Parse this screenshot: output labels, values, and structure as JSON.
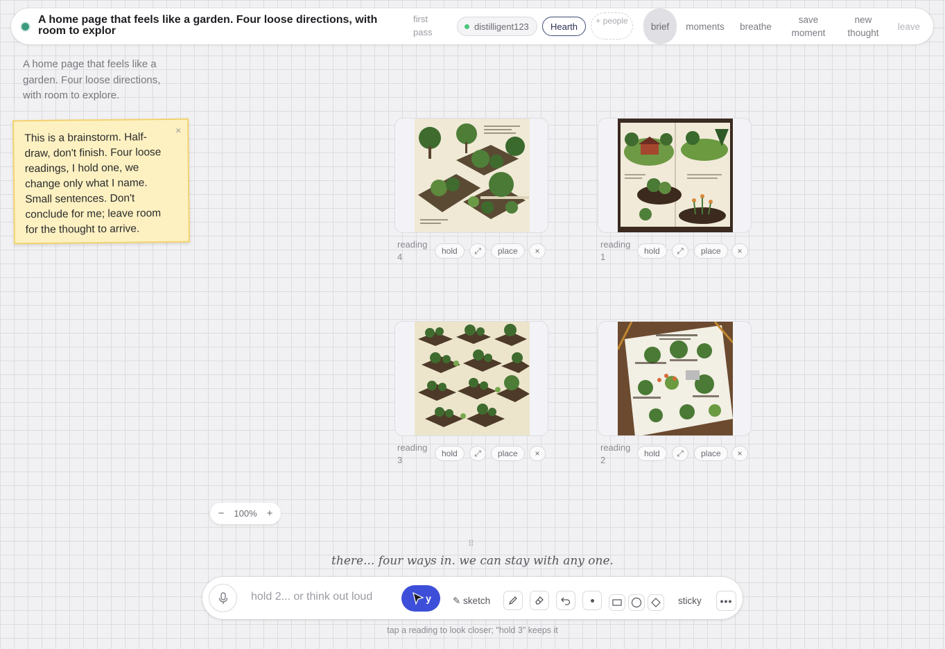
{
  "header": {
    "title": "A home page that feels like a garden. Four loose directions, with room to explor",
    "pass_label": "first pass",
    "user_chip": "distilligent123",
    "space_chip": "Hearth",
    "people_chip": "+ people",
    "nav": [
      {
        "label": "brief",
        "active": true
      },
      {
        "label": "moments"
      },
      {
        "label": "breathe"
      },
      {
        "label": "save moment"
      },
      {
        "label": "new thought"
      },
      {
        "label": "leave",
        "muted": true
      }
    ]
  },
  "brief_text": "A home page that feels like a garden. Four loose directions, with room to explore.",
  "sticky": {
    "text": "This is a brainstorm. Half-draw, don't finish. Four loose readings, I hold one, we change only what I name. Small sentences. Don't conclude for me; leave room for the thought to arrive.",
    "close": "×"
  },
  "readings": [
    {
      "label": "reading 4",
      "hold": "hold",
      "expand": "⤢",
      "place": "place",
      "close": "×"
    },
    {
      "label": "reading 1",
      "hold": "hold",
      "expand": "⤢",
      "place": "place",
      "close": "×"
    },
    {
      "label": "reading 3",
      "hold": "hold",
      "expand": "⤢",
      "place": "place",
      "close": "×"
    },
    {
      "label": "reading 2",
      "hold": "hold",
      "expand": "⤢",
      "place": "place",
      "close": "×"
    }
  ],
  "zoom": {
    "minus": "−",
    "level": "100%",
    "plus": "+"
  },
  "handle": "⠿",
  "whisper": "there... four ways in. we can stay with any one.",
  "composer": {
    "placeholder": "hold 2... or think out loud",
    "send_label": "y",
    "sketch_label": "✎ sketch",
    "sticky_label": "sticky",
    "more_label": "•••"
  },
  "hint": "tap a reading to look closer; \"hold 3\" keeps it",
  "colors": {
    "accent": "#3d4fd8",
    "live": "#3c9a7e",
    "sticky": "#fdf1c2"
  }
}
